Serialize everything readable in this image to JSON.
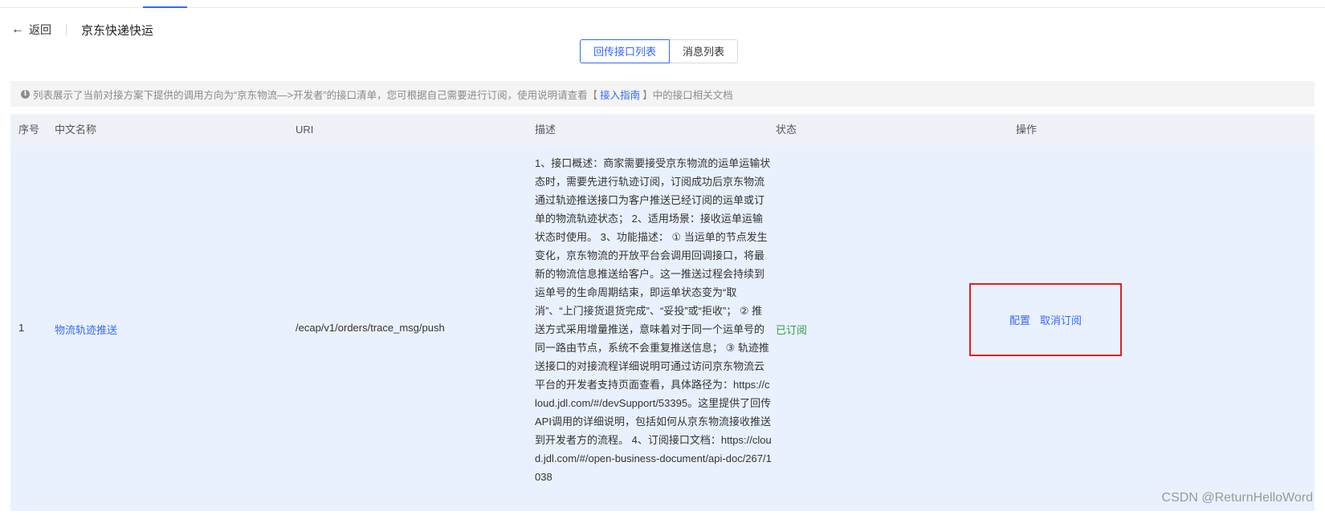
{
  "header": {
    "back_label": "返回",
    "title": "京东快递快运"
  },
  "tabs": [
    {
      "label": "回传接口列表",
      "active": true
    },
    {
      "label": "消息列表",
      "active": false
    }
  ],
  "notice": {
    "text_before": "列表展示了当前对接方案下提供的调用方向为“京东物流—>开发者”的接口清单，您可根据自己需要进行订阅，使用说明请查看【",
    "guide_link": "接入指南",
    "text_after": "】中的接口相关文档"
  },
  "table": {
    "columns": [
      "序号",
      "中文名称",
      "URI",
      "描述",
      "状态",
      "操作"
    ],
    "rows": [
      {
        "index": "1",
        "name": "物流轨迹推送",
        "uri": "/ecap/v1/orders/trace_msg/push",
        "description": "1、接口概述：商家需要接受京东物流的运单运输状态时，需要先进行轨迹订阅，订阅成功后京东物流通过轨迹推送接口为客户推送已经订阅的运单或订单的物流轨迹状态； 2、适用场景：接收运单运输状态时使用。 3、功能描述： ① 当运单的节点发生变化，京东物流的开放平台会调用回调接口，将最新的物流信息推送给客户。这一推送过程会持续到运单号的生命周期结束，即运单状态变为“取消”、“上门接货退货完成”、“妥投”或“拒收”； ② 推送方式采用增量推送，意味着对于同一个运单号的同一路由节点，系统不会重复推送信息； ③ 轨迹推送接口的对接流程详细说明可通过访问京东物流云平台的开发者支持页面查看，具体路径为：https://cloud.jdl.com/#/devSupport/53395。这里提供了回传API调用的详细说明，包括如何从京东物流接收推送到开发者方的流程。 4、订阅接口文档：https://cloud.jdl.com/#/open-business-document/api-doc/267/1038",
        "status": "已订阅",
        "actions": {
          "configure": "配置",
          "unsubscribe": "取消订阅"
        }
      }
    ]
  },
  "watermark": "CSDN @ReturnHelloWord",
  "colors": {
    "accent": "#3768fa",
    "status_green": "#2ca04a",
    "highlight_red": "#e02020"
  }
}
